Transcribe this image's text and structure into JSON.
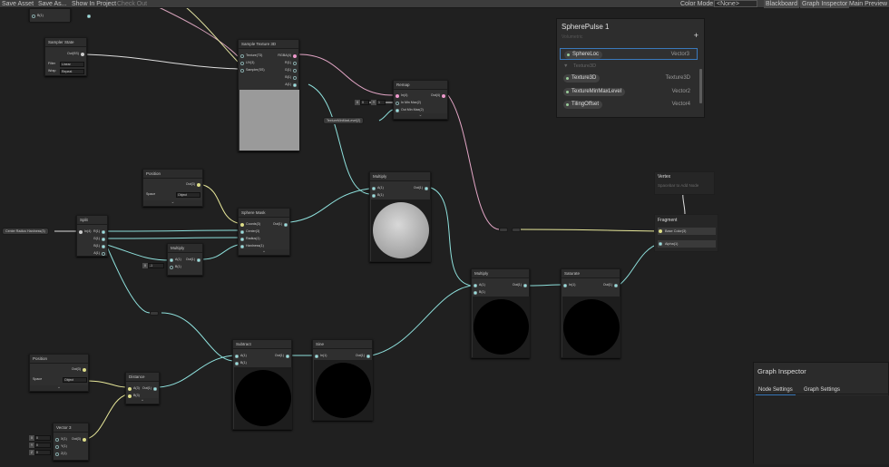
{
  "toolbar": {
    "save_asset": "Save Asset",
    "save_as": "Save As...",
    "show_in_project": "Show In Project",
    "check_out": "Check Out",
    "color_mode_label": "Color Mode",
    "color_mode_value": "<None>",
    "blackboard": "Blackboard",
    "graph_inspector": "Graph Inspector",
    "main_preview": "Main Preview"
  },
  "blackboard": {
    "title": "SpherePulse 1",
    "subtitle": "Volumetric",
    "add_icon": "plus-icon",
    "rows": [
      {
        "name": "SphereLoc",
        "type": "Vector3"
      },
      {
        "name": "Texture3D",
        "type": ""
      },
      {
        "name": "Texture3D",
        "type": "Texture3D"
      },
      {
        "name": "TextureMinMaxLevel",
        "type": "Vector2"
      },
      {
        "name": "TilingOffset",
        "type": "Vector4"
      }
    ]
  },
  "inspector": {
    "title": "Graph Inspector",
    "tab_node": "Node Settings",
    "tab_graph": "Graph Settings"
  },
  "nodes": {
    "top_partial": {
      "ports": [
        "B(1)"
      ]
    },
    "sampler_state": {
      "title": "Sampler State",
      "out": "Out(SS)",
      "filter_label": "Filter",
      "filter_value": "Linear",
      "wrap_label": "Wrap",
      "wrap_value": "Repeat"
    },
    "sample_tex": {
      "title": "Sample Texture 3D",
      "in": [
        "Texture(T3)",
        "UV(3)",
        "Sampler(SS)"
      ],
      "out": [
        "RGBA(4)",
        "R(1)",
        "G(1)",
        "B(1)",
        "A(1)"
      ]
    },
    "remap": {
      "title": "Remap",
      "in": [
        "In(4)",
        "In Min Max(2)",
        "Out Min Max(2)"
      ],
      "out": "Out(4)",
      "x_label": "X",
      "x_value": "0",
      "y_label": "Y",
      "y_value": "1"
    },
    "texminmax_chip": "TextureMinMaxLevel(2)",
    "position_top": {
      "title": "Position",
      "out": "Out(3)",
      "space_label": "Space",
      "space_value": "Object"
    },
    "sphere_mask": {
      "title": "Sphere Mask",
      "in": [
        "Coords(3)",
        "Center(3)",
        "Radius(1)",
        "Hardness(1)"
      ],
      "out": "Out(1)"
    },
    "center_chip": "Center Radius Hardness(3)",
    "split": {
      "title": "Split",
      "in": "In(4)",
      "out": [
        "R(1)",
        "G(1)",
        "B(1)",
        "A(1)"
      ]
    },
    "multiply_small": {
      "title": "Multiply",
      "in": [
        "A(1)",
        "B(1)"
      ],
      "out": "Out(1)",
      "x_label": "X",
      "x_value": "-1"
    },
    "multiply_mid": {
      "title": "Multiply",
      "in": [
        "A(1)",
        "B(1)"
      ],
      "out": "Out(1)"
    },
    "fragment": {
      "title": "Fragment",
      "slots": [
        "Base Color(3)",
        "Alpha(1)"
      ]
    },
    "vertex": {
      "title": "Vertex",
      "hint": "Spacebar to Add Node"
    },
    "multiply_right": {
      "title": "Multiply",
      "in": [
        "A(1)",
        "B(1)"
      ],
      "out": "Out(1)"
    },
    "saturate": {
      "title": "Saturate",
      "in": "In(1)",
      "out": "Out(1)"
    },
    "subtract": {
      "title": "Subtract",
      "in": [
        "A(1)",
        "B(1)"
      ],
      "out": "Out(1)"
    },
    "sine": {
      "title": "Sine",
      "in": "In(1)",
      "out": "Out(1)"
    },
    "position_bottom": {
      "title": "Position",
      "out": "Out(3)",
      "space_label": "Space",
      "space_value": "Object"
    },
    "distance": {
      "title": "Distance",
      "in": [
        "A(3)",
        "B(3)"
      ],
      "out": "Out(1)"
    },
    "vector3": {
      "title": "Vector 3",
      "in": [
        "X(1)",
        "Y(1)",
        "Z(1)"
      ],
      "out": "Out(3)",
      "x_label": "X",
      "x_value": "0",
      "y_label": "Y",
      "y_value": "0",
      "z_label": "Z",
      "z_value": "0"
    }
  }
}
